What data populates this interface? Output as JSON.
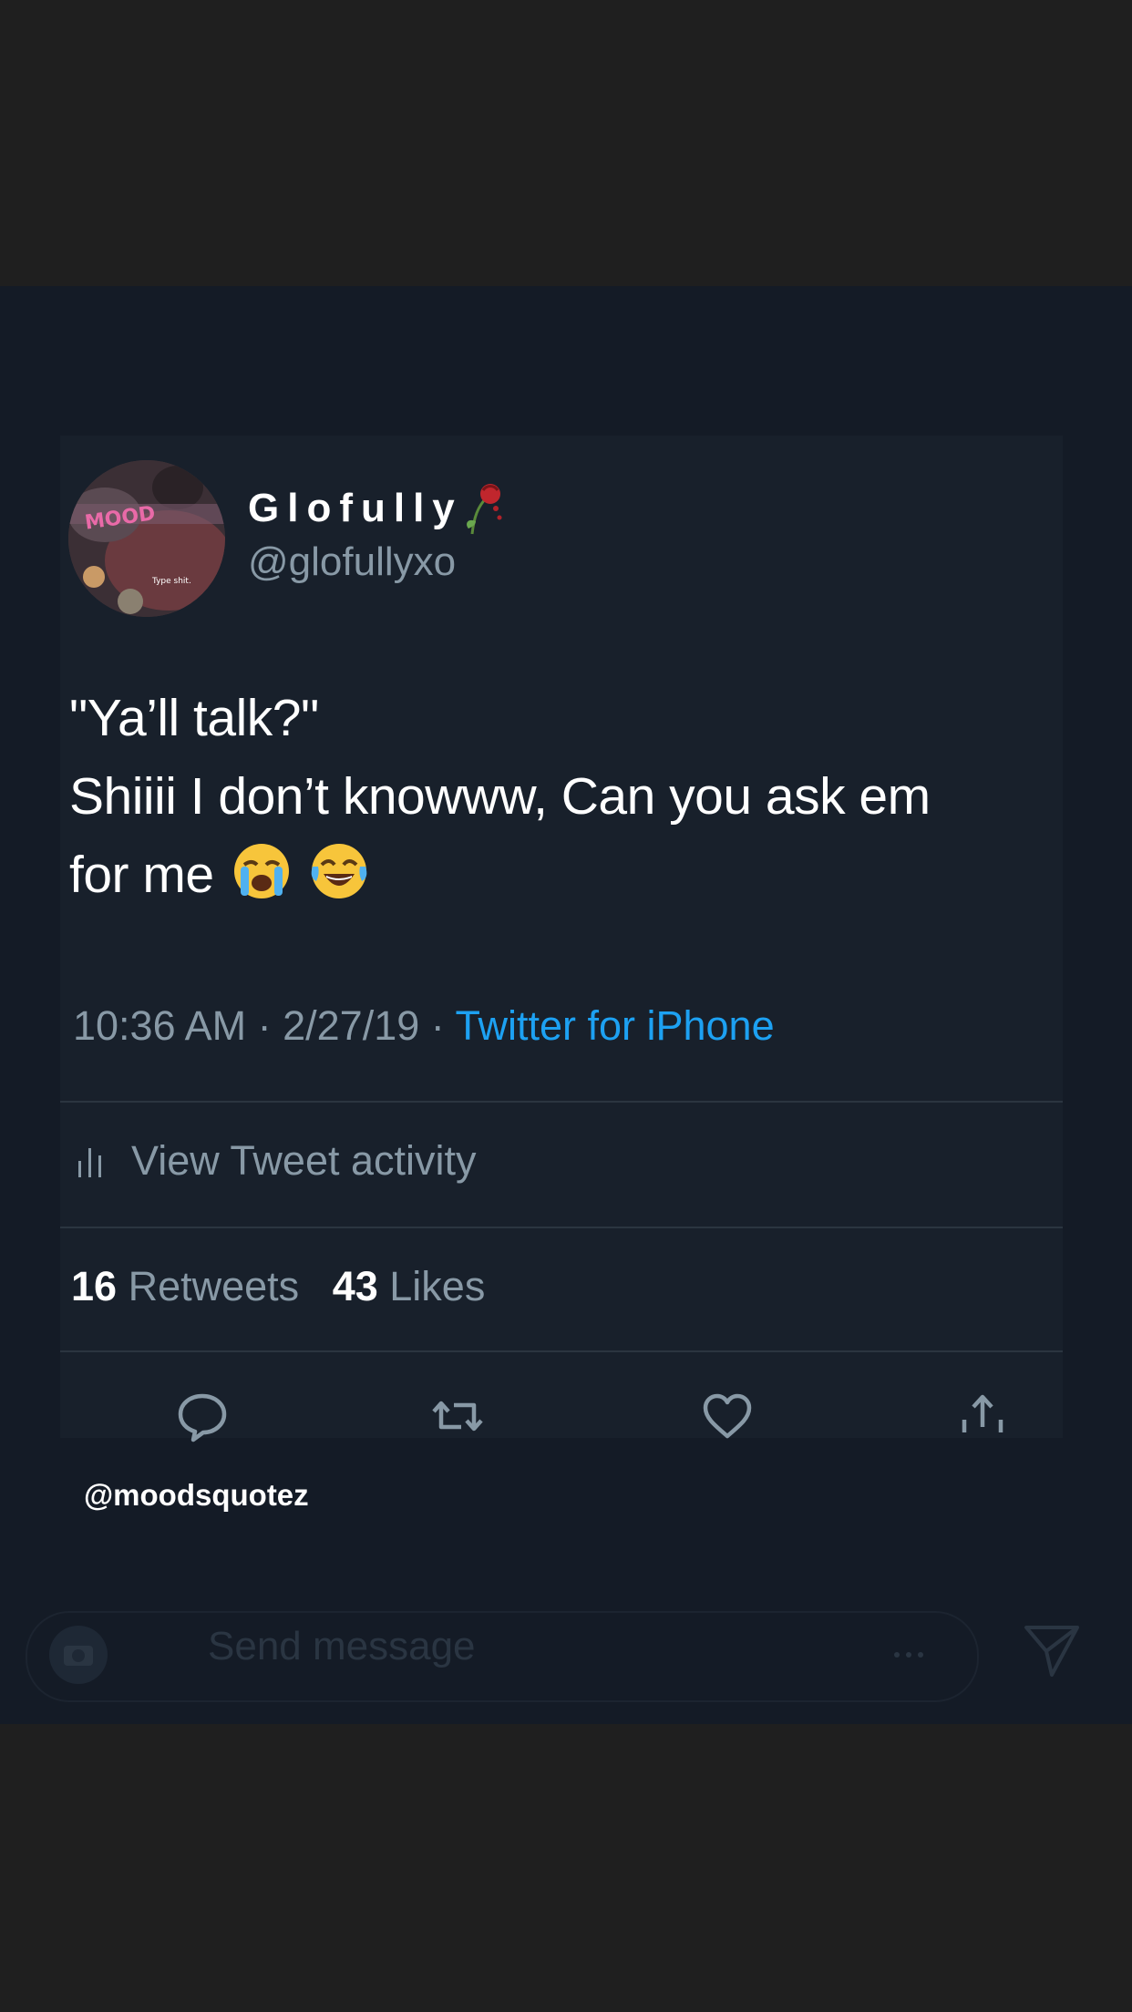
{
  "author": {
    "display_name": "Glofully",
    "handle": "@glofullyxo",
    "name_emoji": "wilted-rose-icon",
    "avatar_text": "MOOD",
    "avatar_caption": "Type shit."
  },
  "tweet": {
    "line1": "\"Ya’ll talk?\"",
    "line2": "Shiiii I don’t knowww, Can you ask em",
    "line3": "for me",
    "emojis": [
      "loudly-crying-face-icon",
      "face-with-tears-of-joy-icon"
    ],
    "time_date": "10:36 AM · 2/27/19 · ",
    "source": "Twitter for iPhone"
  },
  "activity": {
    "label": "View Tweet activity",
    "icon": "bar-chart-icon"
  },
  "stats": {
    "retweets_count": "16",
    "retweets_label": "Retweets",
    "likes_count": "43",
    "likes_label": "Likes"
  },
  "actions": [
    "reply-icon",
    "retweet-icon",
    "like-icon",
    "share-icon"
  ],
  "watermark": "@moodsquotez",
  "story_reply": {
    "placeholder": "Send message",
    "icons": [
      "camera-icon",
      "more-icon",
      "send-icon"
    ]
  },
  "colors": {
    "background": "#1f1f1f",
    "story_background": "#141b26",
    "card_background": "#18202b",
    "text_primary": "#ffffff",
    "text_secondary": "#8899a6",
    "link": "#1da1f2",
    "divider": "#2b3540"
  }
}
